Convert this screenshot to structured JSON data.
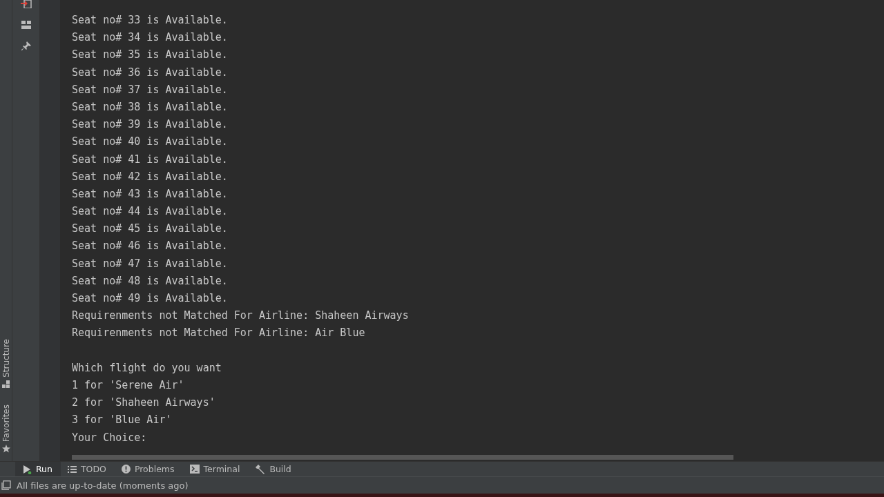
{
  "console": {
    "blocks": [
      [
        "Seat no# 33 is Available.",
        "Seat no# 34 is Available.",
        "Seat no# 35 is Available.",
        "Seat no# 36 is Available.",
        "Seat no# 37 is Available.",
        "Seat no# 38 is Available.",
        "Seat no# 39 is Available.",
        "Seat no# 40 is Available.",
        "Seat no# 41 is Available.",
        "Seat no# 42 is Available.",
        "Seat no# 43 is Available.",
        "Seat no# 44 is Available.",
        "Seat no# 45 is Available.",
        "Seat no# 46 is Available.",
        "Seat no# 47 is Available.",
        "Seat no# 48 is Available.",
        "Seat no# 49 is Available.",
        "Requirenments not Matched For Airline: Shaheen Airways",
        "Requirenments not Matched For Airline: Air Blue"
      ],
      [
        "Which flight do you want",
        "1 for 'Serene Air'",
        "2 for 'Shaheen Airways'",
        "3 for 'Blue Air'",
        "Your Choice:"
      ]
    ]
  },
  "side_tabs": [
    {
      "label": "Structure",
      "kind": "structure"
    },
    {
      "label": "Favorites",
      "kind": "favorites"
    }
  ],
  "tool_tabs": [
    {
      "label": "Run",
      "kind": "run",
      "selected": true
    },
    {
      "label": "TODO",
      "kind": "todo",
      "selected": false
    },
    {
      "label": "Problems",
      "kind": "problems",
      "selected": false
    },
    {
      "label": "Terminal",
      "kind": "terminal",
      "selected": false
    },
    {
      "label": "Build",
      "kind": "build",
      "selected": false
    }
  ],
  "status_bar": {
    "message": "All files are up-to-date (moments ago)"
  }
}
